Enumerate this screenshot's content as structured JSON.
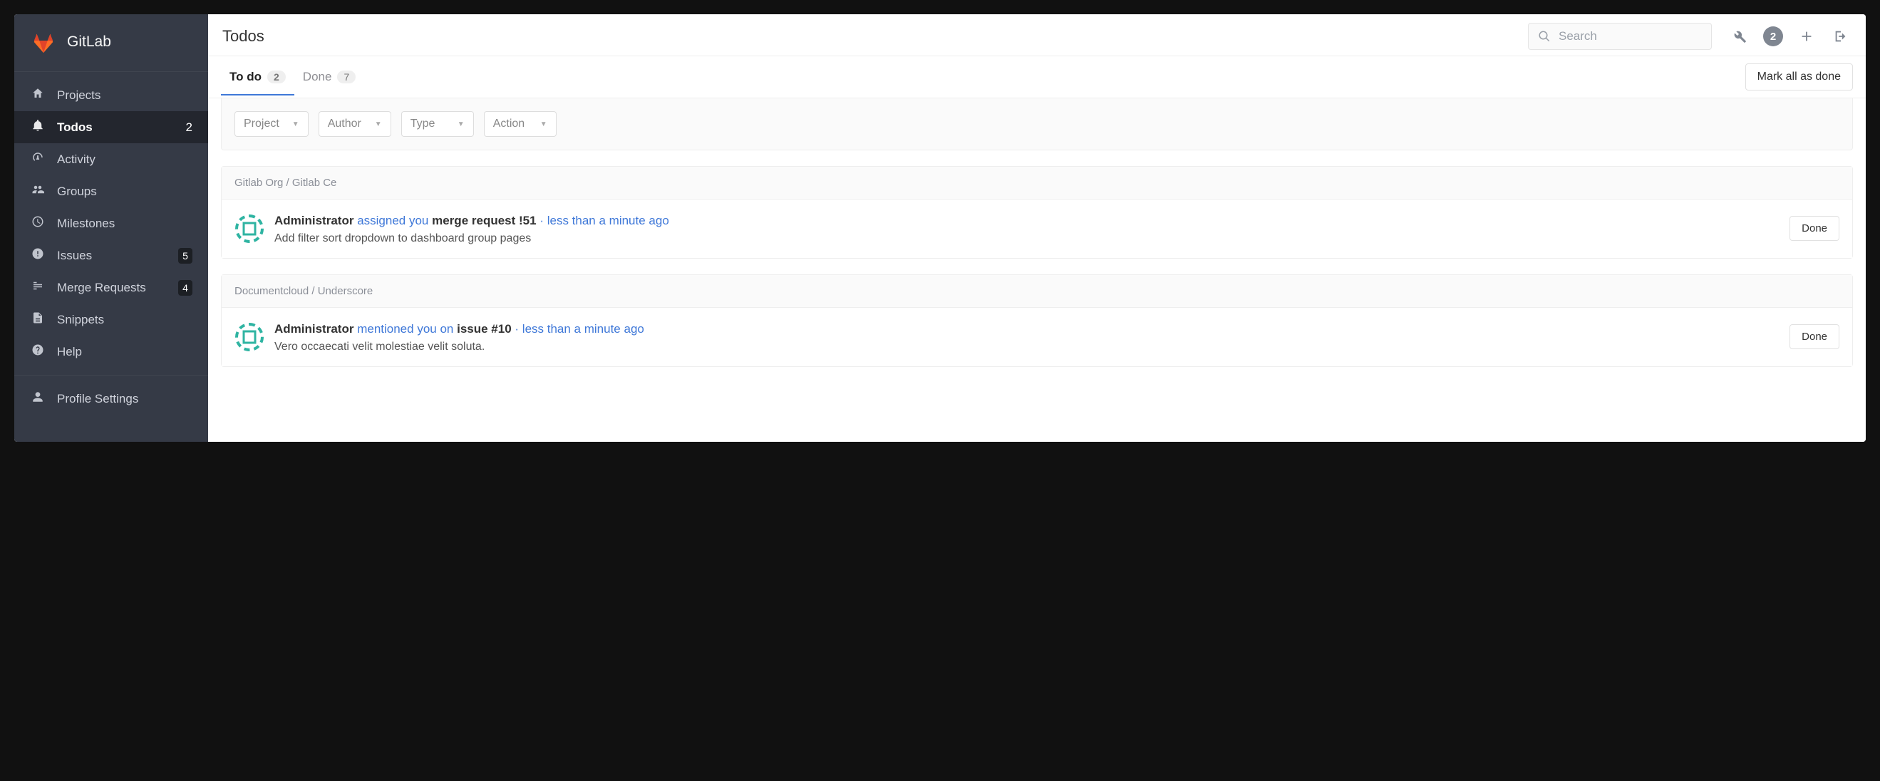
{
  "brand": {
    "title": "GitLab"
  },
  "sidebar": {
    "items": [
      {
        "label": "Projects",
        "icon": "home-icon"
      },
      {
        "label": "Todos",
        "icon": "bell-icon",
        "count": "2",
        "active": true,
        "plainCount": true
      },
      {
        "label": "Activity",
        "icon": "dashboard-icon"
      },
      {
        "label": "Groups",
        "icon": "group-icon"
      },
      {
        "label": "Milestones",
        "icon": "clock-icon"
      },
      {
        "label": "Issues",
        "icon": "exclaim-icon",
        "count": "5"
      },
      {
        "label": "Merge Requests",
        "icon": "merge-icon",
        "count": "4"
      },
      {
        "label": "Snippets",
        "icon": "snippet-icon"
      },
      {
        "label": "Help",
        "icon": "question-icon"
      }
    ],
    "secondary": [
      {
        "label": "Profile Settings",
        "icon": "user-icon"
      }
    ]
  },
  "header": {
    "title": "Todos",
    "search_placeholder": "Search",
    "todo_badge": "2"
  },
  "tabs": {
    "todo_label": "To do",
    "todo_count": "2",
    "done_label": "Done",
    "done_count": "7",
    "mark_all_label": "Mark all as done"
  },
  "filters": {
    "project": "Project",
    "author": "Author",
    "type": "Type",
    "action": "Action"
  },
  "groups": [
    {
      "header": "Gitlab Org / Gitlab Ce",
      "items": [
        {
          "author": "Administrator",
          "action": "assigned you",
          "target": "merge request !51",
          "time": "less than a minute ago",
          "desc": "Add filter sort dropdown to dashboard group pages",
          "done_label": "Done"
        }
      ]
    },
    {
      "header": "Documentcloud / Underscore",
      "items": [
        {
          "author": "Administrator",
          "action": "mentioned you on",
          "target": "issue #10",
          "time": "less than a minute ago",
          "desc": "Vero occaecati velit molestiae velit soluta.",
          "done_label": "Done"
        }
      ]
    }
  ]
}
